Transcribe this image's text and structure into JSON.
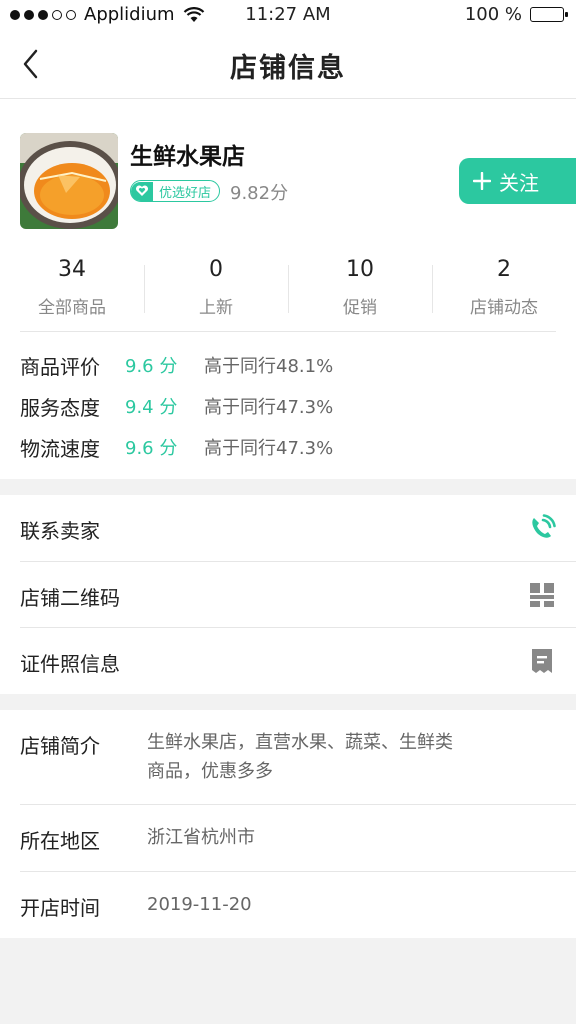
{
  "status_bar": {
    "carrier": "Applidium",
    "time": "11:27 AM",
    "battery": "100 %"
  },
  "nav": {
    "title": "店铺信息"
  },
  "store": {
    "name": "生鲜水果店",
    "badge": "优选好店",
    "score": "9.82分",
    "follow_label": "关注"
  },
  "stats": [
    {
      "value": "34",
      "label": "全部商品"
    },
    {
      "value": "0",
      "label": "上新"
    },
    {
      "value": "10",
      "label": "促销"
    },
    {
      "value": "2",
      "label": "店铺动态"
    }
  ],
  "ratings": [
    {
      "label": "商品评价",
      "value": "9.6 分",
      "compare": "高于同行48.1%"
    },
    {
      "label": "服务态度",
      "value": "9.4 分",
      "compare": "高于同行47.3%"
    },
    {
      "label": "物流速度",
      "value": "9.6 分",
      "compare": "高于同行47.3%"
    }
  ],
  "actions": [
    {
      "label": "联系卖家",
      "icon": "phone-icon"
    },
    {
      "label": "店铺二维码",
      "icon": "qr-code-icon"
    },
    {
      "label": "证件照信息",
      "icon": "certificate-icon"
    }
  ],
  "info": {
    "intro_label": "店铺简介",
    "intro_line1": "生鲜水果店，直营水果、蔬菜、生鲜类",
    "intro_line2": "商品，优惠多多",
    "region_label": "所在地区",
    "region_value": "浙江省杭州市",
    "opened_label": "开店时间",
    "opened_value": "2019-11-20"
  },
  "colors": {
    "accent": "#2cc8a0",
    "background": "#f2f2f2"
  }
}
